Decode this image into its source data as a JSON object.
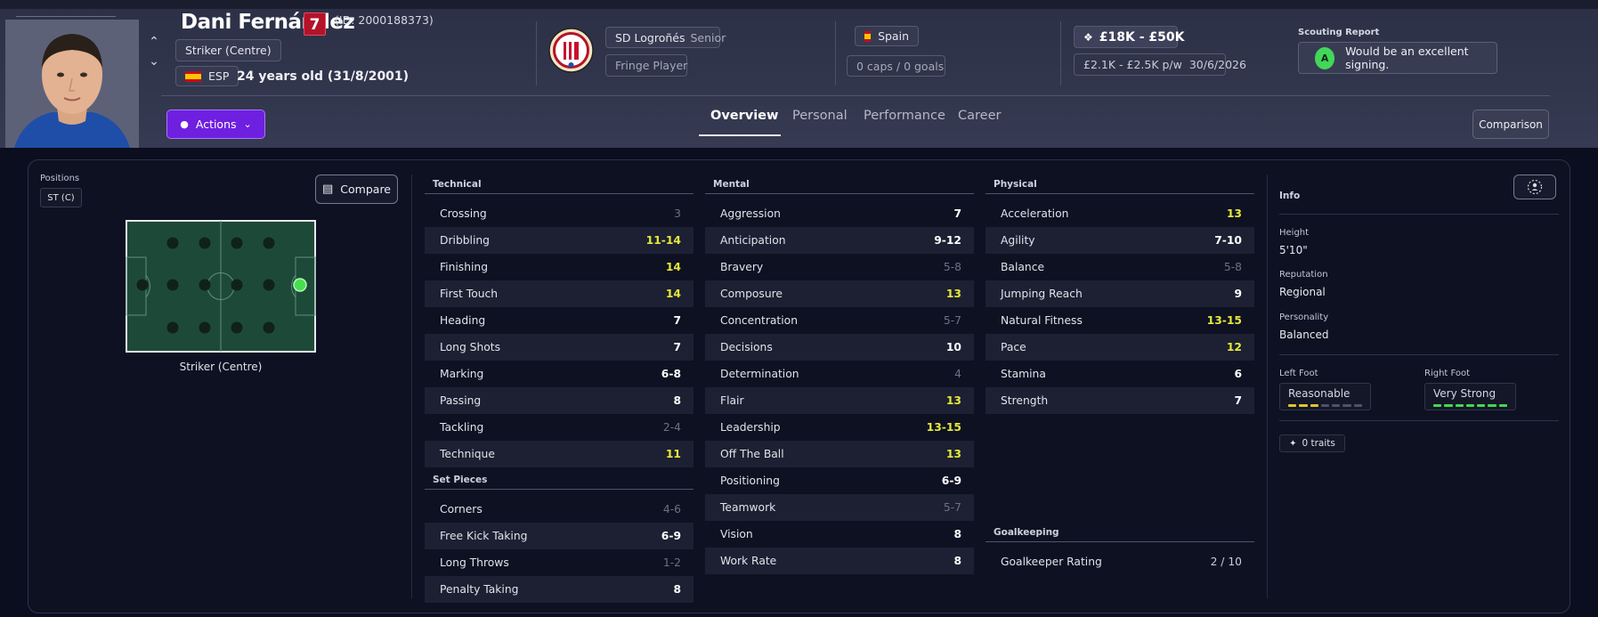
{
  "player": {
    "name": "Dani Fernández",
    "squad_number": "7",
    "id_text": "(ID: 2000188373)",
    "position_chip": "Striker (Centre)",
    "nationality": "ESP",
    "age_text": "24 years old (31/8/2001)"
  },
  "club": {
    "name": "SD Logroñés",
    "level": "Senior",
    "squad_status": "Fringe Player"
  },
  "nation": {
    "name": "Spain",
    "caps_text": "0 caps / 0 goals"
  },
  "value": {
    "range": "£18K - £50K",
    "wage": "£2.1K - £2.5K p/w",
    "contract_end": "30/6/2026"
  },
  "scouting": {
    "title": "Scouting Report",
    "grade": "A",
    "text": "Would be an excellent signing."
  },
  "actions_label": "Actions",
  "tabs": [
    "Overview",
    "Personal",
    "Performance",
    "Career"
  ],
  "comparison_label": "Comparison",
  "positions": {
    "label": "Positions",
    "chip": "ST (C)",
    "compare_label": "Compare",
    "caption": "Striker (Centre)"
  },
  "technical": {
    "title": "Technical",
    "rows": [
      {
        "name": "Crossing",
        "value": "3",
        "tone": "lo"
      },
      {
        "name": "Dribbling",
        "value": "11-14",
        "tone": "hi"
      },
      {
        "name": "Finishing",
        "value": "14",
        "tone": "hi"
      },
      {
        "name": "First Touch",
        "value": "14",
        "tone": "hi"
      },
      {
        "name": "Heading",
        "value": "7",
        "tone": "mid"
      },
      {
        "name": "Long Shots",
        "value": "7",
        "tone": "mid"
      },
      {
        "name": "Marking",
        "value": "6-8",
        "tone": "mid"
      },
      {
        "name": "Passing",
        "value": "8",
        "tone": "mid"
      },
      {
        "name": "Tackling",
        "value": "2-4",
        "tone": "lo"
      },
      {
        "name": "Technique",
        "value": "11",
        "tone": "hi"
      }
    ]
  },
  "set_pieces": {
    "title": "Set Pieces",
    "rows": [
      {
        "name": "Corners",
        "value": "4-6",
        "tone": "lo"
      },
      {
        "name": "Free Kick Taking",
        "value": "6-9",
        "tone": "mid"
      },
      {
        "name": "Long Throws",
        "value": "1-2",
        "tone": "lo"
      },
      {
        "name": "Penalty Taking",
        "value": "8",
        "tone": "mid"
      }
    ]
  },
  "mental": {
    "title": "Mental",
    "rows": [
      {
        "name": "Aggression",
        "value": "7",
        "tone": "mid"
      },
      {
        "name": "Anticipation",
        "value": "9-12",
        "tone": "mid"
      },
      {
        "name": "Bravery",
        "value": "5-8",
        "tone": "lo"
      },
      {
        "name": "Composure",
        "value": "13",
        "tone": "hi"
      },
      {
        "name": "Concentration",
        "value": "5-7",
        "tone": "lo"
      },
      {
        "name": "Decisions",
        "value": "10",
        "tone": "mid"
      },
      {
        "name": "Determination",
        "value": "4",
        "tone": "lo"
      },
      {
        "name": "Flair",
        "value": "13",
        "tone": "hi"
      },
      {
        "name": "Leadership",
        "value": "13-15",
        "tone": "hi"
      },
      {
        "name": "Off The Ball",
        "value": "13",
        "tone": "hi"
      },
      {
        "name": "Positioning",
        "value": "6-9",
        "tone": "mid"
      },
      {
        "name": "Teamwork",
        "value": "5-7",
        "tone": "lo"
      },
      {
        "name": "Vision",
        "value": "8",
        "tone": "mid"
      },
      {
        "name": "Work Rate",
        "value": "8",
        "tone": "mid"
      }
    ]
  },
  "physical": {
    "title": "Physical",
    "rows": [
      {
        "name": "Acceleration",
        "value": "13",
        "tone": "hi"
      },
      {
        "name": "Agility",
        "value": "7-10",
        "tone": "mid"
      },
      {
        "name": "Balance",
        "value": "5-8",
        "tone": "lo"
      },
      {
        "name": "Jumping Reach",
        "value": "9",
        "tone": "mid"
      },
      {
        "name": "Natural Fitness",
        "value": "13-15",
        "tone": "hi"
      },
      {
        "name": "Pace",
        "value": "12",
        "tone": "hi"
      },
      {
        "name": "Stamina",
        "value": "6",
        "tone": "mid"
      },
      {
        "name": "Strength",
        "value": "7",
        "tone": "mid"
      }
    ]
  },
  "goalkeeping": {
    "title": "Goalkeeping",
    "rows": [
      {
        "name": "Goalkeeper Rating",
        "value": "2 / 10",
        "tone": "plain"
      }
    ]
  },
  "info": {
    "title": "Info",
    "height_label": "Height",
    "height": "5'10\"",
    "reputation_label": "Reputation",
    "reputation": "Regional",
    "personality_label": "Personality",
    "personality": "Balanced",
    "left_foot_label": "Left Foot",
    "left_foot": "Reasonable",
    "left_foot_level": 3,
    "right_foot_label": "Right Foot",
    "right_foot": "Very Strong",
    "right_foot_level": 7,
    "foot_scale_max": 7,
    "traits": "0 traits"
  },
  "colors": {
    "accent_purple": "#6f1fe0",
    "highlight_yellow": "#e4e83a",
    "low_grey": "#6c7185",
    "scout_green": "#43d65a",
    "number_red": "#b3132a"
  }
}
